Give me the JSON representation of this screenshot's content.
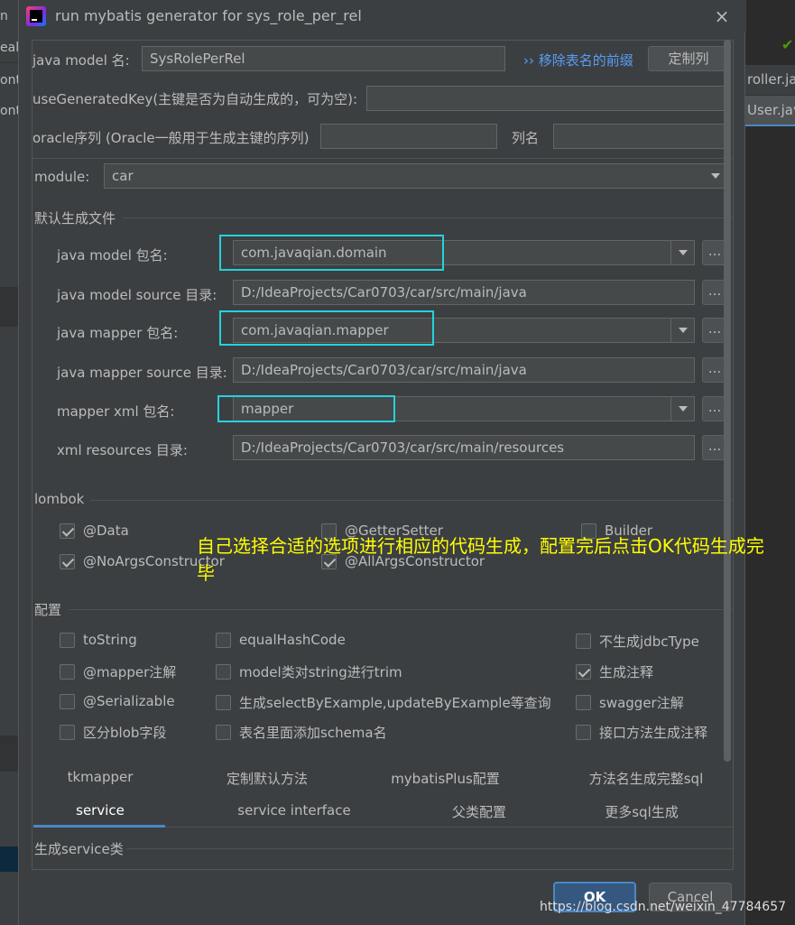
{
  "ide": {
    "left_fragments": [
      "n",
      "eal",
      "ont",
      "ont"
    ],
    "right_tabs": [
      "roller.jav",
      "User.jav"
    ]
  },
  "dialog": {
    "title": "run mybatis generator for sys_role_per_rel",
    "close_glyph": "×"
  },
  "top": {
    "java_model_label": "java model 名:",
    "java_model_value": "SysRolePerRel",
    "remove_prefix_link": "›› 移除表名的前缀",
    "custom_columns_button": "定制列",
    "use_generated_key_label": "useGeneratedKey(主键是否为自动生成的，可为空):",
    "use_generated_key_value": "",
    "oracle_seq_label": "oracle序列 (Oracle一般用于生成主键的序列)",
    "oracle_seq_value": "",
    "column_name_label": "列名",
    "column_name_value": ""
  },
  "module": {
    "label": "module:",
    "value": "car"
  },
  "default_files": {
    "section_title": "默认生成文件",
    "rows": [
      {
        "label": "java model 包名:",
        "value": "com.javaqian.domain"
      },
      {
        "label": "java model source 目录:",
        "value": "D:/IdeaProjects/Car0703/car/src/main/java"
      },
      {
        "label": "java mapper 包名:",
        "value": "com.javaqian.mapper"
      },
      {
        "label": "java mapper source 目录:",
        "value": "D:/IdeaProjects/Car0703/car/src/main/java"
      },
      {
        "label": "mapper xml 包名:",
        "value": "mapper"
      },
      {
        "label": "xml resources 目录:",
        "value": "D:/IdeaProjects/Car0703/car/src/main/resources"
      }
    ],
    "browse_glyph": "..."
  },
  "lombok": {
    "section_title": "lombok",
    "options": [
      {
        "label": "@Data",
        "checked": true
      },
      {
        "label": "@GetterSetter",
        "checked": false
      },
      {
        "label": "Builder",
        "checked": false
      },
      {
        "label": "@NoArgsConstructor",
        "checked": true
      },
      {
        "label": "@AllArgsConstructor",
        "checked": true
      }
    ]
  },
  "config": {
    "section_title": "配置",
    "options": [
      {
        "label": "toString",
        "checked": false
      },
      {
        "label": "equalHashCode",
        "checked": false
      },
      {
        "label": "不生成jdbcType",
        "checked": false
      },
      {
        "label": "@mapper注解",
        "checked": false
      },
      {
        "label": "model类对string进行trim",
        "checked": false
      },
      {
        "label": "生成注释",
        "checked": true
      },
      {
        "label": "@Serializable",
        "checked": false
      },
      {
        "label": "生成selectByExample,updateByExample等查询",
        "checked": false
      },
      {
        "label": "swagger注解",
        "checked": false
      },
      {
        "label": "区分blob字段",
        "checked": false
      },
      {
        "label": "表名里面添加schema名",
        "checked": false
      },
      {
        "label": "接口方法生成注释",
        "checked": false
      }
    ]
  },
  "annotation": "自己选择合适的选项进行相应的代码生成，配置完后点击OK代码生成完毕",
  "tabs": {
    "row1": [
      "tkmapper",
      "定制默认方法",
      "mybatisPlus配置",
      "方法名生成完整sql"
    ],
    "row2": [
      "service",
      "service interface",
      "父类配置",
      "更多sql生成"
    ],
    "active": "service"
  },
  "service_section_title": "生成service类",
  "buttons": {
    "ok": "OK",
    "cancel": "Cancel"
  },
  "watermark": "https://blog.csdn.net/weixin_47784657",
  "colors": {
    "highlight": "#23d3dc",
    "annotation": "#ffff00",
    "accent": "#4a88c7"
  }
}
